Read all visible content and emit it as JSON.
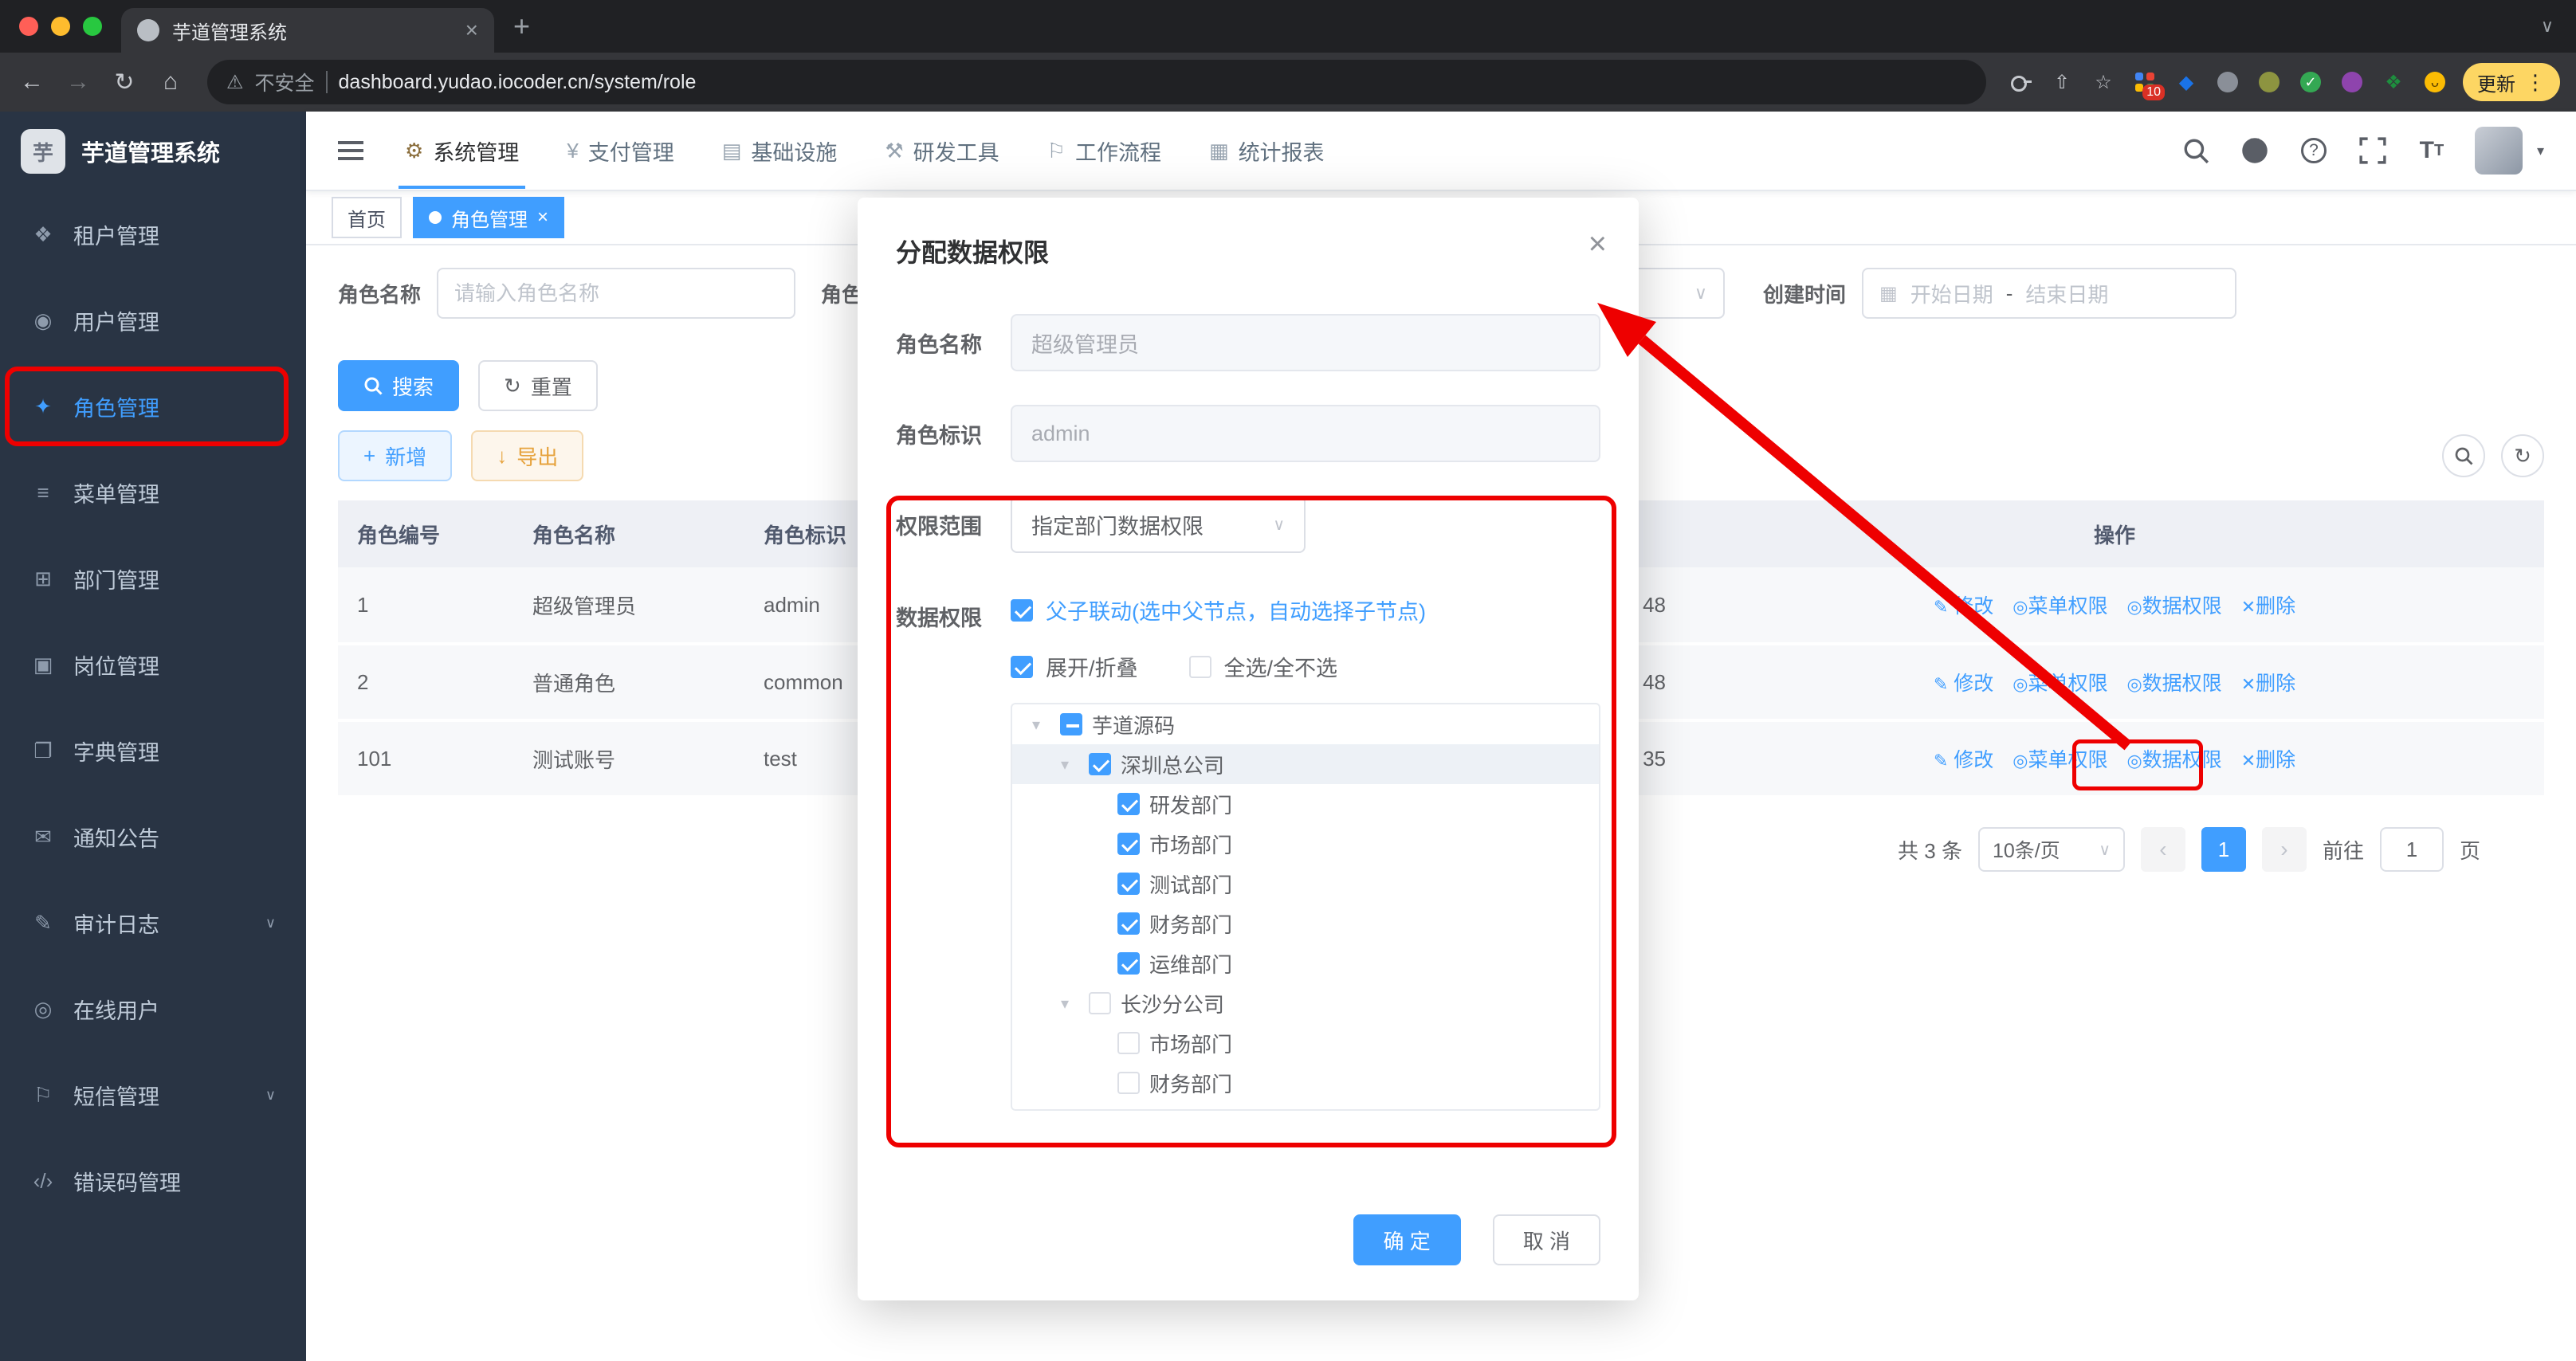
{
  "browser": {
    "tab_title": "芋道管理系统",
    "security_label": "不安全",
    "url": "dashboard.yudao.iocoder.cn/system/role",
    "extension_badge": "10",
    "update_label": "更新"
  },
  "sidebar": {
    "logo_title": "芋道管理系统",
    "items": [
      {
        "label": "租户管理",
        "icon": "tenant-icon"
      },
      {
        "label": "用户管理",
        "icon": "user-icon"
      },
      {
        "label": "角色管理",
        "icon": "role-icon",
        "active": true
      },
      {
        "label": "菜单管理",
        "icon": "menu-icon"
      },
      {
        "label": "部门管理",
        "icon": "dept-icon"
      },
      {
        "label": "岗位管理",
        "icon": "post-icon"
      },
      {
        "label": "字典管理",
        "icon": "dict-icon"
      },
      {
        "label": "通知公告",
        "icon": "notice-icon"
      },
      {
        "label": "审计日志",
        "icon": "audit-log-icon",
        "expandable": true
      },
      {
        "label": "在线用户",
        "icon": "online-user-icon"
      },
      {
        "label": "短信管理",
        "icon": "sms-icon",
        "expandable": true
      },
      {
        "label": "错误码管理",
        "icon": "error-code-icon"
      }
    ]
  },
  "topnav": {
    "items": [
      {
        "label": "系统管理",
        "active": true
      },
      {
        "label": "支付管理"
      },
      {
        "label": "基础设施"
      },
      {
        "label": "研发工具"
      },
      {
        "label": "工作流程"
      },
      {
        "label": "统计报表"
      }
    ]
  },
  "tags": {
    "home": "首页",
    "active_tag": "角色管理"
  },
  "filters": {
    "role_name_label": "角色名称",
    "role_name_placeholder": "请输入角色名称",
    "partial_label": "角色",
    "create_time_label": "创建时间",
    "date_start_placeholder": "开始日期",
    "date_separator": "-",
    "date_end_placeholder": "结束日期",
    "search_button": "搜索",
    "reset_button": "重置",
    "add_button": "新增",
    "export_button": "导出"
  },
  "table": {
    "headers": [
      "角色编号",
      "角色名称",
      "角色标识",
      "",
      "操作"
    ],
    "rows": [
      {
        "id": "1",
        "name": "超级管理员",
        "key": "admin",
        "time_fragment": "48"
      },
      {
        "id": "2",
        "name": "普通角色",
        "key": "common",
        "time_fragment": "48"
      },
      {
        "id": "101",
        "name": "测试账号",
        "key": "test",
        "time_fragment": "35"
      }
    ],
    "actions": {
      "edit": "修改",
      "menu_perm": "菜单权限",
      "data_perm": "数据权限",
      "delete": "删除"
    }
  },
  "pagination": {
    "total": "共 3 条",
    "page_size": "10条/页",
    "current_page": "1",
    "goto_label": "前往",
    "goto_value": "1",
    "page_label": "页"
  },
  "dialog": {
    "title": "分配数据权限",
    "role_name_label": "角色名称",
    "role_name_value": "超级管理员",
    "role_key_label": "角色标识",
    "role_key_value": "admin",
    "scope_label": "权限范围",
    "scope_value": "指定部门数据权限",
    "data_perm_label": "数据权限",
    "linkage_label": "父子联动(选中父节点，自动选择子节点)",
    "expand_label": "展开/折叠",
    "select_all_label": "全选/全不选",
    "tree": [
      {
        "label": "芋道源码",
        "level": 0,
        "state": "indeterminate",
        "caret": true
      },
      {
        "label": "深圳总公司",
        "level": 1,
        "state": "checked",
        "caret": true,
        "highlighted": true
      },
      {
        "label": "研发部门",
        "level": 2,
        "state": "checked"
      },
      {
        "label": "市场部门",
        "level": 2,
        "state": "checked"
      },
      {
        "label": "测试部门",
        "level": 2,
        "state": "checked"
      },
      {
        "label": "财务部门",
        "level": 2,
        "state": "checked"
      },
      {
        "label": "运维部门",
        "level": 2,
        "state": "checked"
      },
      {
        "label": "长沙分公司",
        "level": 1,
        "state": "unchecked",
        "caret": true
      },
      {
        "label": "市场部门",
        "level": 2,
        "state": "unchecked"
      },
      {
        "label": "财务部门",
        "level": 2,
        "state": "unchecked"
      }
    ],
    "confirm_button": "确 定",
    "cancel_button": "取 消"
  },
  "colors": {
    "primary": "#409eff",
    "annotation_red": "#ee0000",
    "sidebar_bg": "#293444",
    "warning": "#e6a23c",
    "update_pill": "#fdd663"
  }
}
